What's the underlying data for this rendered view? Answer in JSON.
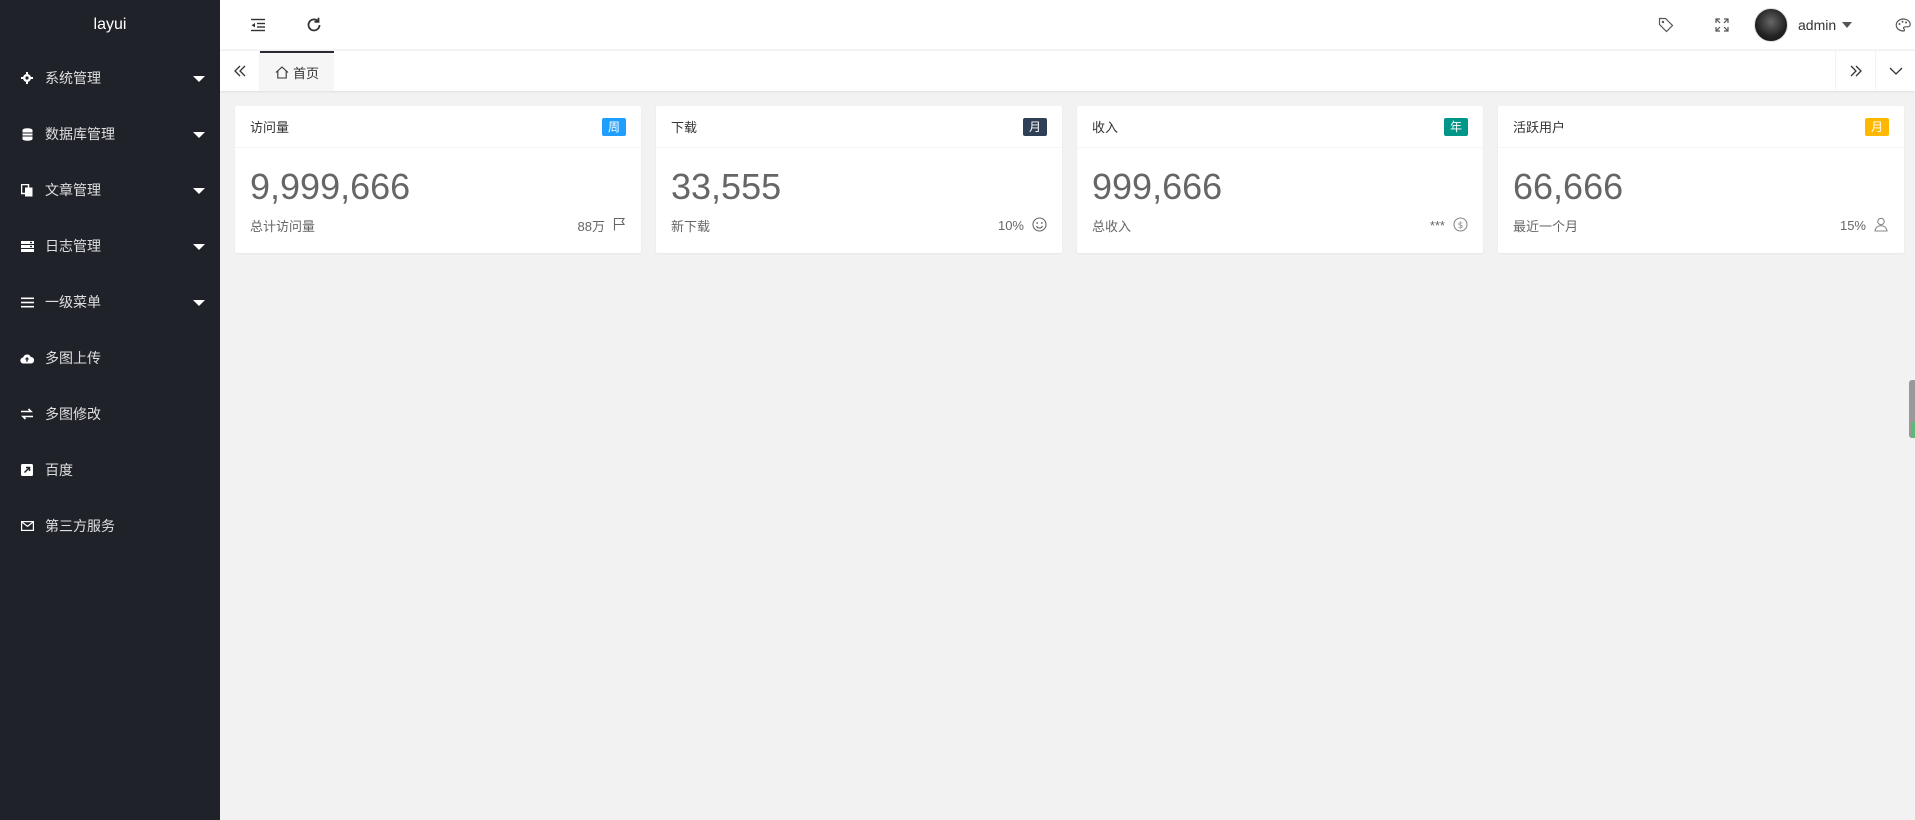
{
  "sidebar": {
    "logo": "layui",
    "items": [
      {
        "label": "系统管理",
        "icon": "gear-icon",
        "has_caret": true
      },
      {
        "label": "数据库管理",
        "icon": "database-icon",
        "has_caret": true
      },
      {
        "label": "文章管理",
        "icon": "documents-icon",
        "has_caret": true
      },
      {
        "label": "日志管理",
        "icon": "server-icon",
        "has_caret": true
      },
      {
        "label": "一级菜单",
        "icon": "menu-icon",
        "has_caret": true
      },
      {
        "label": "多图上传",
        "icon": "cloud-upload-icon",
        "has_caret": false
      },
      {
        "label": "多图修改",
        "icon": "exchange-icon",
        "has_caret": false
      },
      {
        "label": "百度",
        "icon": "external-link-icon",
        "has_caret": false
      },
      {
        "label": "第三方服务",
        "icon": "envelope-icon",
        "has_caret": false
      }
    ]
  },
  "header": {
    "user": "admin",
    "icons": [
      "indent-icon",
      "refresh-icon",
      "tag-icon",
      "fullscreen-icon",
      "theme-icon"
    ]
  },
  "tabs": {
    "home": "首页"
  },
  "cards": [
    {
      "title": "访问量",
      "badge": "周",
      "badge_color": "#1e9fff",
      "value": "9,999,666",
      "desc": "总计访问量",
      "stat": "88万",
      "icon": "flag-icon"
    },
    {
      "title": "下载",
      "badge": "月",
      "badge_color": "#2f4056",
      "value": "33,555",
      "desc": "新下载",
      "stat": "10%",
      "icon": "smile-icon"
    },
    {
      "title": "收入",
      "badge": "年",
      "badge_color": "#009688",
      "value": "999,666",
      "desc": "总收入",
      "stat": "***",
      "icon": "dollar-icon"
    },
    {
      "title": "活跃用户",
      "badge": "月",
      "badge_color": "#ffb800",
      "value": "66,666",
      "desc": "最近一个月",
      "stat": "15%",
      "icon": "user-icon"
    }
  ],
  "colors": {
    "sidebar_bg": "#20222a",
    "content_bg": "#f2f2f2"
  }
}
